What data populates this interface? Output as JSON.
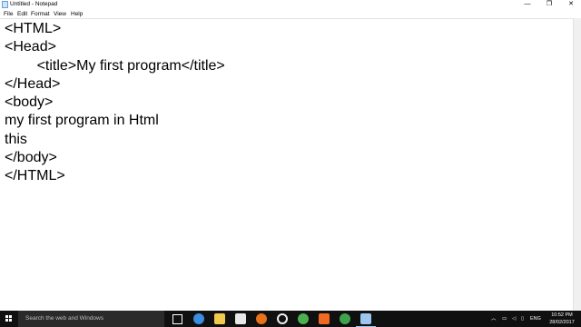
{
  "window": {
    "title": "Untitled - Notepad",
    "controls": {
      "minimize": "—",
      "restore": "❐",
      "close": "✕"
    }
  },
  "menu": [
    "File",
    "Edit",
    "Format",
    "View",
    "Help"
  ],
  "editor": {
    "content": "<HTML>\n<Head>\n\t\t<title>My first program</title>\n</Head>\n<body>\nmy first program in Html\nthis\n</body>\n</HTML>"
  },
  "taskbar": {
    "search_placeholder": "Search the web and Windows",
    "pinned": [
      {
        "icon": "task-view-icon",
        "color": "#ffffff"
      },
      {
        "icon": "edge-icon",
        "color": "#3b8ddd"
      },
      {
        "icon": "file-explorer-icon",
        "color": "#f2c94c"
      },
      {
        "icon": "store-icon",
        "color": "#e8e8e8"
      },
      {
        "icon": "firefox-icon",
        "color": "#e8711a"
      },
      {
        "icon": "media-player-icon",
        "color": "#eeeeee"
      },
      {
        "icon": "chrome-icon",
        "color": "#4caf50"
      },
      {
        "icon": "orange-app-icon",
        "color": "#f06a24"
      },
      {
        "icon": "chrome-alt-icon",
        "color": "#3fa34d"
      },
      {
        "icon": "notepad-icon",
        "color": "#9cc6ee"
      }
    ],
    "tray": {
      "language": "ENG",
      "time": "10:52 PM",
      "date": "28/02/2017"
    }
  }
}
